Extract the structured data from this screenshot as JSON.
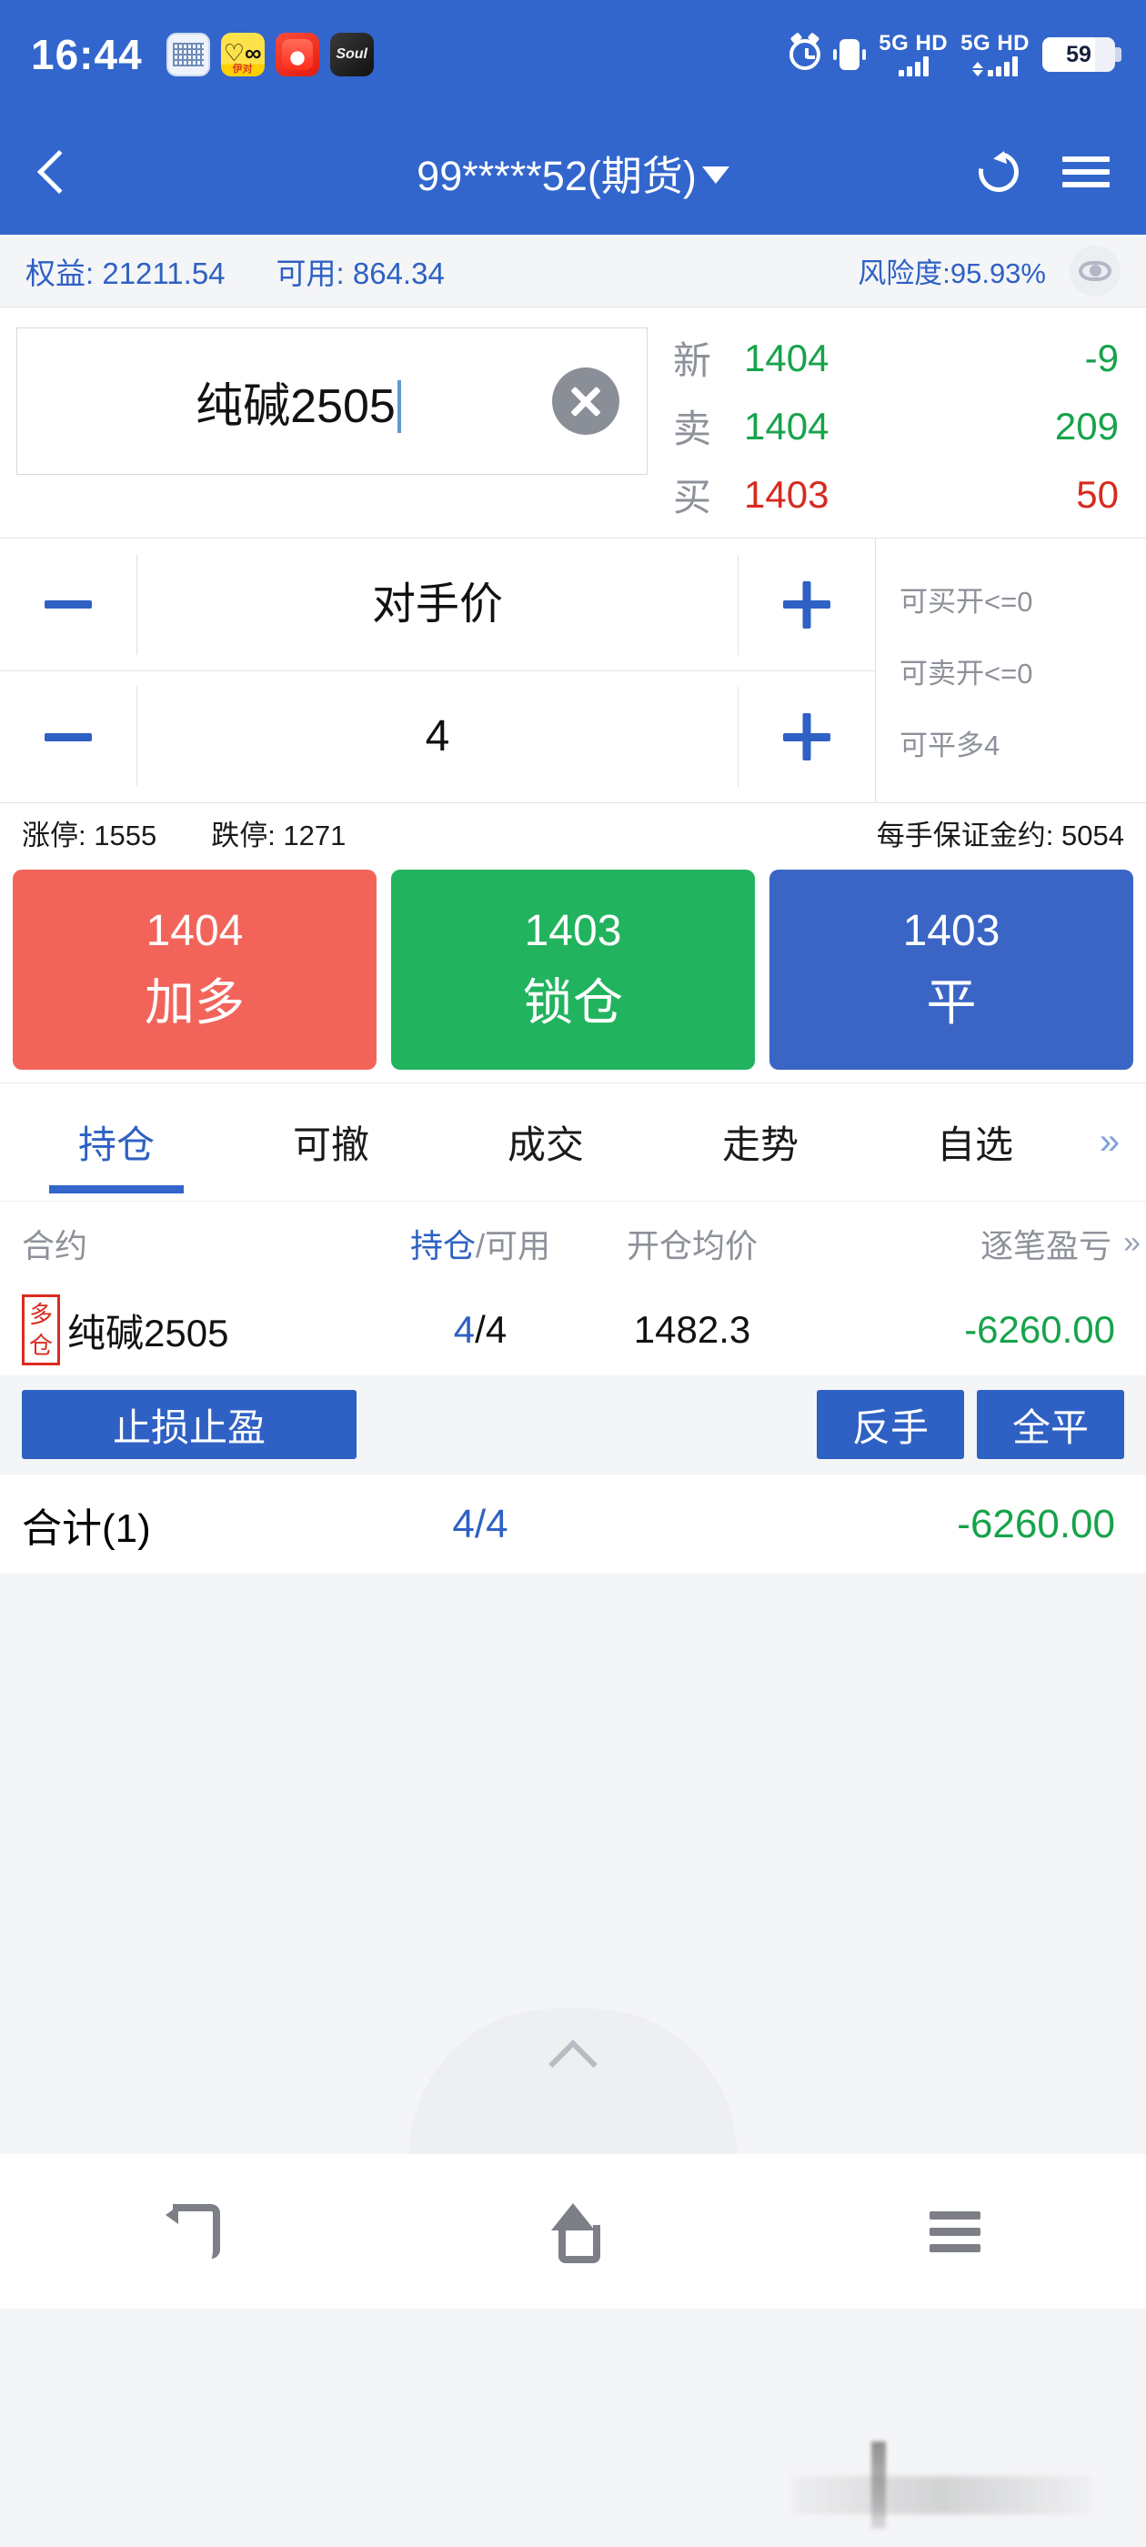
{
  "status_bar": {
    "time": "16:44",
    "apps": [
      {
        "name": "qr-app-icon",
        "label": ""
      },
      {
        "name": "yidui-app-icon",
        "label": "伊对"
      },
      {
        "name": "red-app-icon",
        "label": ""
      },
      {
        "name": "soul-app-icon",
        "label": "Soul"
      }
    ],
    "alarm_icon": "alarm-icon",
    "vibrate_icon": "vibrate-icon",
    "signal_1": {
      "network": "5G",
      "volte": "HD"
    },
    "signal_2": {
      "network": "5G",
      "volte": "HD"
    },
    "battery": "59"
  },
  "app_bar": {
    "back_icon": "back-chevron-icon",
    "title": "99*****52(期货)",
    "dropdown_icon": "chevron-down-icon",
    "refresh_icon": "refresh-icon",
    "menu_icon": "list-menu-icon"
  },
  "account_bar": {
    "equity": "权益: 21211.54",
    "available": "可用: 864.34",
    "risk": "风险度:95.93%",
    "eye_icon": "eye-icon"
  },
  "order": {
    "search_value": "纯碱2505",
    "clear_icon": "clear-circle-icon",
    "quotes": [
      {
        "label": "新",
        "price": "1404",
        "volume": "-9",
        "color": "green"
      },
      {
        "label": "卖",
        "price": "1404",
        "volume": "209",
        "color": "green"
      },
      {
        "label": "买",
        "price": "1403",
        "volume": "50",
        "color": "red"
      }
    ],
    "price_value": "对手价",
    "qty_value": "4",
    "minus_icon": "minus-icon",
    "plus_icon": "plus-icon",
    "can_buy_open": "可买开<=0",
    "can_sell_open": "可卖开<=0",
    "can_close_long": "可平多4",
    "upper_limit": "涨停: 1555",
    "lower_limit": "跌停: 1271",
    "margin_per_lot": "每手保证金约: 5054",
    "buttons": [
      {
        "price": "1404",
        "label": "加多",
        "color": "#f2645a"
      },
      {
        "price": "1403",
        "label": "锁仓",
        "color": "#22b35e"
      },
      {
        "price": "1403",
        "label": "平",
        "color": "#3a65c4"
      }
    ]
  },
  "tabs": {
    "items": [
      "持仓",
      "可撤",
      "成交",
      "走势",
      "自选"
    ],
    "active_index": 0,
    "more_icon": "double-chevron-right-icon"
  },
  "position_table": {
    "headers": {
      "contract": "合约",
      "position_active": "持仓",
      "position_rest": "/可用",
      "avg_price": "开仓均价",
      "pnl": "逐笔盈亏",
      "more_icon": "double-chevron-right-icon"
    },
    "rows": [
      {
        "badge": "多仓",
        "contract": "纯碱2505",
        "position": "4",
        "available": "/4",
        "avg_price": "1482.3",
        "pnl": "-6260.00",
        "pnl_color": "#16a34a"
      }
    ],
    "row_buttons": {
      "stop_loss_profit": "止损止盈",
      "reverse": "反手",
      "close_all": "全平"
    },
    "total": {
      "label": "合计(1)",
      "position": "4/4",
      "pnl": "-6260.00"
    }
  },
  "bottom": {
    "pull_handle_icon": "chevron-up-icon",
    "nav_back_icon": "nav-back-icon",
    "nav_home_icon": "nav-home-icon",
    "nav_recents_icon": "nav-recents-icon"
  }
}
